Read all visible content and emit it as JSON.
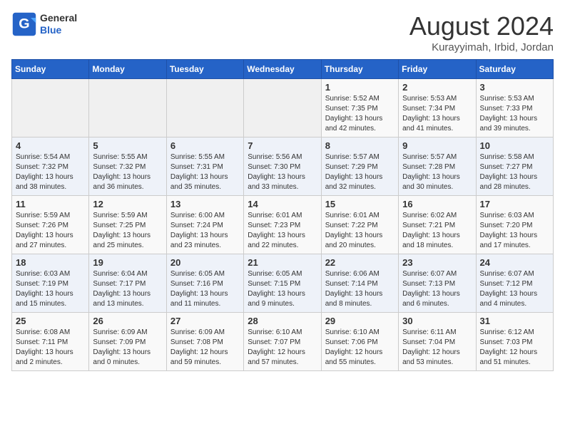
{
  "header": {
    "logo_line1": "General",
    "logo_line2": "Blue",
    "title": "August 2024",
    "subtitle": "Kurayyimah, Irbid, Jordan"
  },
  "weekdays": [
    "Sunday",
    "Monday",
    "Tuesday",
    "Wednesday",
    "Thursday",
    "Friday",
    "Saturday"
  ],
  "weeks": [
    [
      {
        "day": "",
        "detail": ""
      },
      {
        "day": "",
        "detail": ""
      },
      {
        "day": "",
        "detail": ""
      },
      {
        "day": "",
        "detail": ""
      },
      {
        "day": "1",
        "detail": "Sunrise: 5:52 AM\nSunset: 7:35 PM\nDaylight: 13 hours\nand 42 minutes."
      },
      {
        "day": "2",
        "detail": "Sunrise: 5:53 AM\nSunset: 7:34 PM\nDaylight: 13 hours\nand 41 minutes."
      },
      {
        "day": "3",
        "detail": "Sunrise: 5:53 AM\nSunset: 7:33 PM\nDaylight: 13 hours\nand 39 minutes."
      }
    ],
    [
      {
        "day": "4",
        "detail": "Sunrise: 5:54 AM\nSunset: 7:32 PM\nDaylight: 13 hours\nand 38 minutes."
      },
      {
        "day": "5",
        "detail": "Sunrise: 5:55 AM\nSunset: 7:32 PM\nDaylight: 13 hours\nand 36 minutes."
      },
      {
        "day": "6",
        "detail": "Sunrise: 5:55 AM\nSunset: 7:31 PM\nDaylight: 13 hours\nand 35 minutes."
      },
      {
        "day": "7",
        "detail": "Sunrise: 5:56 AM\nSunset: 7:30 PM\nDaylight: 13 hours\nand 33 minutes."
      },
      {
        "day": "8",
        "detail": "Sunrise: 5:57 AM\nSunset: 7:29 PM\nDaylight: 13 hours\nand 32 minutes."
      },
      {
        "day": "9",
        "detail": "Sunrise: 5:57 AM\nSunset: 7:28 PM\nDaylight: 13 hours\nand 30 minutes."
      },
      {
        "day": "10",
        "detail": "Sunrise: 5:58 AM\nSunset: 7:27 PM\nDaylight: 13 hours\nand 28 minutes."
      }
    ],
    [
      {
        "day": "11",
        "detail": "Sunrise: 5:59 AM\nSunset: 7:26 PM\nDaylight: 13 hours\nand 27 minutes."
      },
      {
        "day": "12",
        "detail": "Sunrise: 5:59 AM\nSunset: 7:25 PM\nDaylight: 13 hours\nand 25 minutes."
      },
      {
        "day": "13",
        "detail": "Sunrise: 6:00 AM\nSunset: 7:24 PM\nDaylight: 13 hours\nand 23 minutes."
      },
      {
        "day": "14",
        "detail": "Sunrise: 6:01 AM\nSunset: 7:23 PM\nDaylight: 13 hours\nand 22 minutes."
      },
      {
        "day": "15",
        "detail": "Sunrise: 6:01 AM\nSunset: 7:22 PM\nDaylight: 13 hours\nand 20 minutes."
      },
      {
        "day": "16",
        "detail": "Sunrise: 6:02 AM\nSunset: 7:21 PM\nDaylight: 13 hours\nand 18 minutes."
      },
      {
        "day": "17",
        "detail": "Sunrise: 6:03 AM\nSunset: 7:20 PM\nDaylight: 13 hours\nand 17 minutes."
      }
    ],
    [
      {
        "day": "18",
        "detail": "Sunrise: 6:03 AM\nSunset: 7:19 PM\nDaylight: 13 hours\nand 15 minutes."
      },
      {
        "day": "19",
        "detail": "Sunrise: 6:04 AM\nSunset: 7:17 PM\nDaylight: 13 hours\nand 13 minutes."
      },
      {
        "day": "20",
        "detail": "Sunrise: 6:05 AM\nSunset: 7:16 PM\nDaylight: 13 hours\nand 11 minutes."
      },
      {
        "day": "21",
        "detail": "Sunrise: 6:05 AM\nSunset: 7:15 PM\nDaylight: 13 hours\nand 9 minutes."
      },
      {
        "day": "22",
        "detail": "Sunrise: 6:06 AM\nSunset: 7:14 PM\nDaylight: 13 hours\nand 8 minutes."
      },
      {
        "day": "23",
        "detail": "Sunrise: 6:07 AM\nSunset: 7:13 PM\nDaylight: 13 hours\nand 6 minutes."
      },
      {
        "day": "24",
        "detail": "Sunrise: 6:07 AM\nSunset: 7:12 PM\nDaylight: 13 hours\nand 4 minutes."
      }
    ],
    [
      {
        "day": "25",
        "detail": "Sunrise: 6:08 AM\nSunset: 7:11 PM\nDaylight: 13 hours\nand 2 minutes."
      },
      {
        "day": "26",
        "detail": "Sunrise: 6:09 AM\nSunset: 7:09 PM\nDaylight: 13 hours\nand 0 minutes."
      },
      {
        "day": "27",
        "detail": "Sunrise: 6:09 AM\nSunset: 7:08 PM\nDaylight: 12 hours\nand 59 minutes."
      },
      {
        "day": "28",
        "detail": "Sunrise: 6:10 AM\nSunset: 7:07 PM\nDaylight: 12 hours\nand 57 minutes."
      },
      {
        "day": "29",
        "detail": "Sunrise: 6:10 AM\nSunset: 7:06 PM\nDaylight: 12 hours\nand 55 minutes."
      },
      {
        "day": "30",
        "detail": "Sunrise: 6:11 AM\nSunset: 7:04 PM\nDaylight: 12 hours\nand 53 minutes."
      },
      {
        "day": "31",
        "detail": "Sunrise: 6:12 AM\nSunset: 7:03 PM\nDaylight: 12 hours\nand 51 minutes."
      }
    ]
  ]
}
